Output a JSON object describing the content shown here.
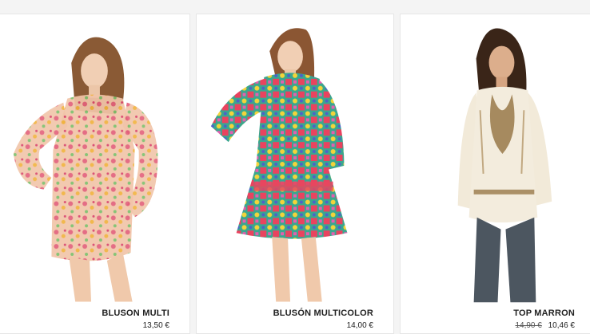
{
  "products": [
    {
      "name": "BLUSON MULTI",
      "price": "13,50 €",
      "image": "model-floral-sheer-tunic",
      "garment_color": "#e9a17d"
    },
    {
      "name": "BLUSÓN MULTICOLOR",
      "price": "14,00 €",
      "image": "model-multicolor-print-tunic",
      "garment_color": "#2f9d8d"
    },
    {
      "name": "TOP MARRON",
      "old_price": "14,90 €",
      "price": "10,46 €",
      "image": "model-embroidered-cream-top",
      "garment_color": "#efe6d4"
    }
  ]
}
